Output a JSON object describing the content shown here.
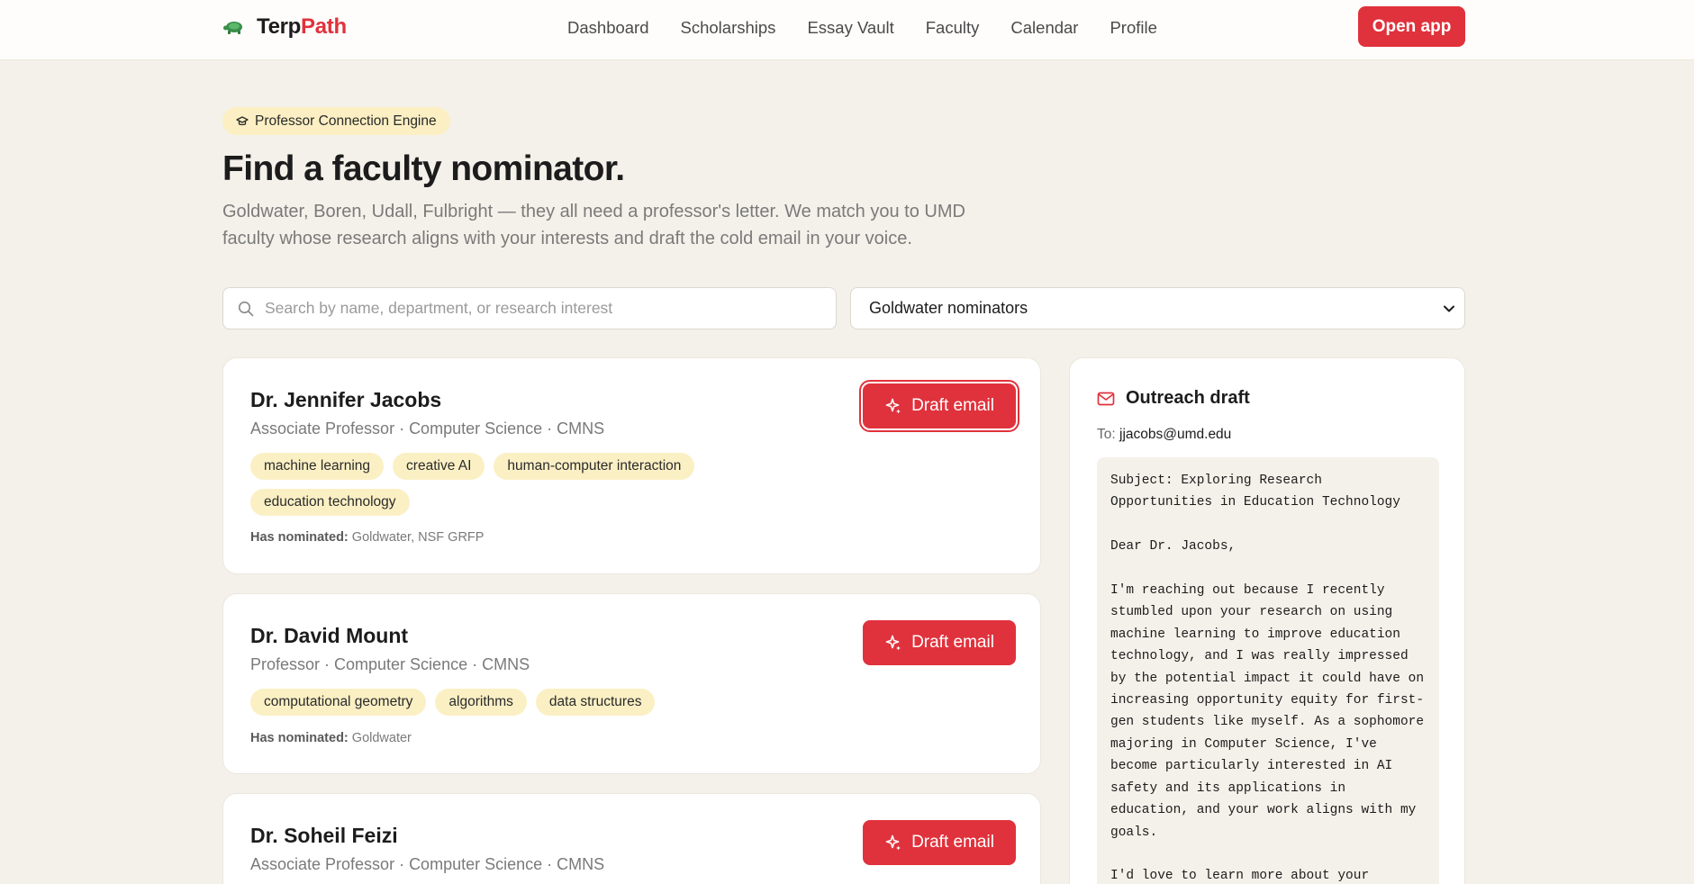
{
  "nav": {
    "brand_part1": "Terp",
    "brand_part2": "Path",
    "links": [
      "Dashboard",
      "Scholarships",
      "Essay Vault",
      "Faculty",
      "Calendar",
      "Profile"
    ],
    "open_app": "Open app"
  },
  "hero": {
    "badge": "Professor Connection Engine",
    "title": "Find a faculty nominator.",
    "subtitle": "Goldwater, Boren, Udall, Fulbright — they all need a professor's letter. We match you to UMD faculty whose research aligns with your interests and draft the cold email in your voice."
  },
  "search": {
    "placeholder": "Search by name, department, or research interest",
    "value": ""
  },
  "filter": {
    "selected": "Goldwater nominators"
  },
  "faculty": [
    {
      "name": "Dr. Jennifer Jacobs",
      "role": "Associate Professor · Computer Science · CMNS",
      "tags": [
        "machine learning",
        "creative AI",
        "human-computer interaction",
        "education technology"
      ],
      "nominated_label": "Has nominated:",
      "nominated": "Goldwater, NSF GRFP",
      "button": "Draft email"
    },
    {
      "name": "Dr. David Mount",
      "role": "Professor · Computer Science · CMNS",
      "tags": [
        "computational geometry",
        "algorithms",
        "data structures"
      ],
      "nominated_label": "Has nominated:",
      "nominated": "Goldwater",
      "button": "Draft email"
    },
    {
      "name": "Dr. Soheil Feizi",
      "role": "Associate Professor · Computer Science · CMNS",
      "button": "Draft email"
    }
  ],
  "outreach": {
    "title": "Outreach draft",
    "to_label": "To:",
    "to": "jjacobs@umd.edu",
    "body": "Subject: Exploring Research Opportunities in Education Technology\n\nDear Dr. Jacobs,\n\nI'm reaching out because I recently stumbled upon your research on using machine learning to improve education technology, and I was really impressed by the potential impact it could have on increasing opportunity equity for first-gen students like myself. As a sophomore majoring in Computer Science, I've become particularly interested in AI safety and its applications in education, and your work aligns with my goals.\n\nI'd love to learn more about your experiences and insights in this area."
  },
  "colors": {
    "accent": "#e0323c",
    "tag_bg": "#fbf0c4",
    "page_bg": "#f4f1ea"
  }
}
